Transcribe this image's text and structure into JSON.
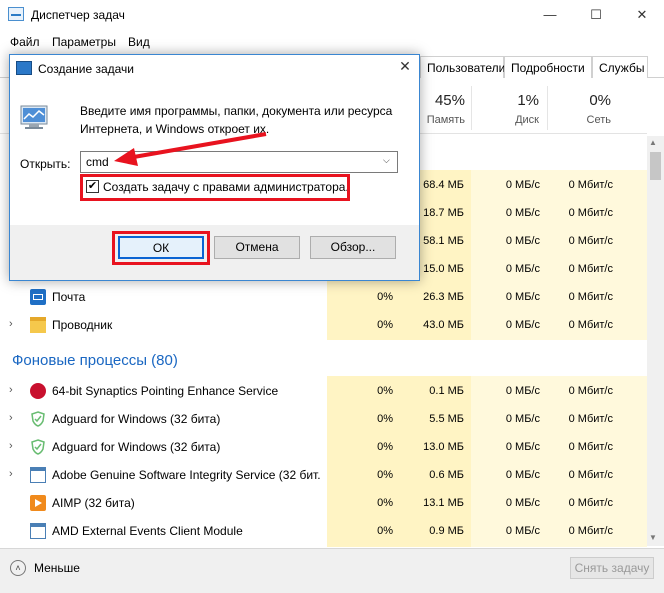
{
  "window": {
    "title": "Диспетчер задач",
    "controls": {
      "minimize": "—",
      "maximize": "☐",
      "close": "✕"
    }
  },
  "menubar": [
    "Файл",
    "Параметры",
    "Вид"
  ],
  "tabs": [
    "Пользователи",
    "Подробности",
    "Службы"
  ],
  "columns": {
    "memory": {
      "percent": "45%",
      "label": "Память"
    },
    "disk": {
      "percent": "1%",
      "label": "Диск"
    },
    "network": {
      "percent": "0%",
      "label": "Сеть"
    }
  },
  "hidden_rows": [
    {
      "memory": "68.4 МБ",
      "disk": "0 МБ/с",
      "network": "0 Мбит/с"
    },
    {
      "memory": "18.7 МБ",
      "disk": "0 МБ/с",
      "network": "0 Мбит/с"
    },
    {
      "memory": "58.1 МБ",
      "disk": "0 МБ/с",
      "network": "0 Мбит/с"
    },
    {
      "memory": "15.0 МБ",
      "disk": "0 МБ/с",
      "network": "0 Мбит/с"
    }
  ],
  "apps": [
    {
      "name": "Почта",
      "cpu": "0%",
      "memory": "26.3 МБ",
      "disk": "0 МБ/с",
      "network": "0 Мбит/с",
      "icon": "mail-icon",
      "expandable": false
    },
    {
      "name": "Проводник",
      "cpu": "0%",
      "memory": "43.0 МБ",
      "disk": "0 МБ/с",
      "network": "0 Мбит/с",
      "icon": "folder-icon",
      "expandable": true
    }
  ],
  "background_section": {
    "title": "Фоновые процессы (80)"
  },
  "processes": [
    {
      "name": "64-bit Synaptics Pointing Enhance Service",
      "cpu": "0%",
      "memory": "0.1 МБ",
      "disk": "0 МБ/с",
      "network": "0 Мбит/с",
      "icon": "synaptics-icon"
    },
    {
      "name": "Adguard for Windows (32 бита)",
      "cpu": "0%",
      "memory": "5.5 МБ",
      "disk": "0 МБ/с",
      "network": "0 Мбит/с",
      "icon": "adguard-icon"
    },
    {
      "name": "Adguard for Windows (32 бита)",
      "cpu": "0%",
      "memory": "13.0 МБ",
      "disk": "0 МБ/с",
      "network": "0 Мбит/с",
      "icon": "adguard-icon"
    },
    {
      "name": "Adobe Genuine Software Integrity Service (32 бит...",
      "cpu": "0%",
      "memory": "0.6 МБ",
      "disk": "0 МБ/с",
      "network": "0 Мбит/с",
      "icon": "service-window-icon"
    },
    {
      "name": "AIMP (32 бита)",
      "cpu": "0%",
      "memory": "13.1 МБ",
      "disk": "0 МБ/с",
      "network": "0 Мбит/с",
      "icon": "aimp-icon"
    },
    {
      "name": "AMD External Events Client Module",
      "cpu": "0%",
      "memory": "0.9 МБ",
      "disk": "0 МБ/с",
      "network": "0 Мбит/с",
      "icon": "service-window-icon"
    }
  ],
  "footer": {
    "less_label": "Меньше",
    "end_task_label": "Снять задачу"
  },
  "dialog": {
    "title": "Создание задачи",
    "description_line1": "Введите имя программы, папки, документа или ресурса",
    "description_line2": "Интернета, и Windows откроет их.",
    "open_label": "Открыть:",
    "open_value": "cmd",
    "admin_checkbox_label": "Создать задачу с правами администратора.",
    "admin_checked": true,
    "ok_label": "ОК",
    "cancel_label": "Отмена",
    "browse_label": "Обзор..."
  },
  "colors": {
    "highlight_red": "#e8131f",
    "section_blue": "#1a67c2",
    "column_yellow": "#fff4c4",
    "dialog_border": "#3a86d1"
  }
}
